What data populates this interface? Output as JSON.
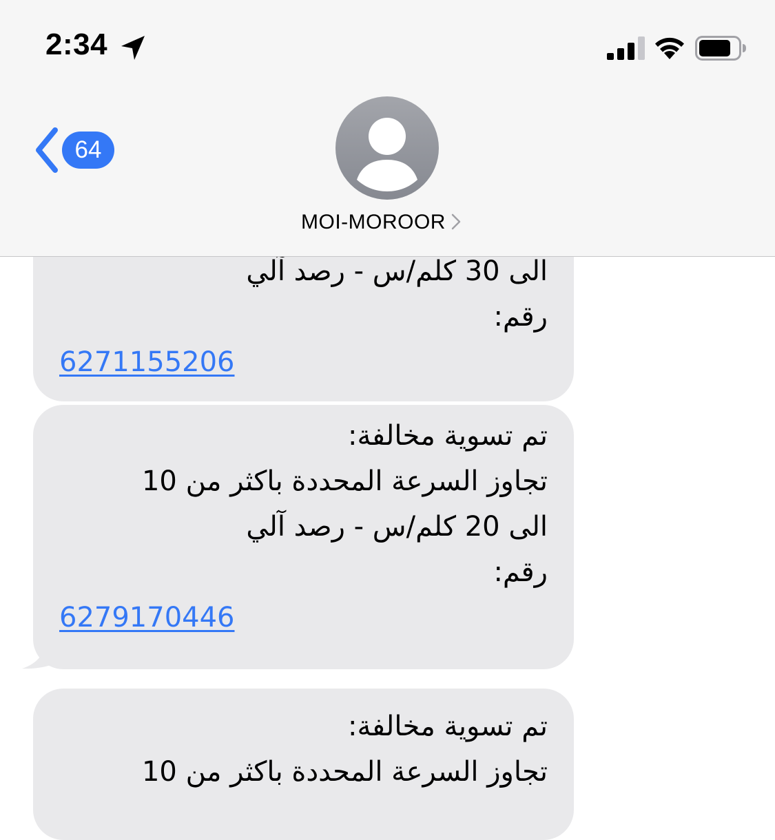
{
  "status_bar": {
    "time": "2:34",
    "location_icon": "location-arrow-icon",
    "signal_icon": "cellular-signal-icon",
    "wifi_icon": "wifi-icon",
    "battery_icon": "battery-icon"
  },
  "header": {
    "back_icon": "chevron-left-icon",
    "unread_count": "64",
    "avatar_icon": "person-icon",
    "contact_name": "MOI-MOROOR",
    "contact_chevron_icon": "chevron-right-icon"
  },
  "messages": [
    {
      "lines": [
        "الى 30 كلم/س - رصد آلي",
        "رقم:"
      ],
      "link": "6271155206"
    },
    {
      "lines": [
        "تم تسوية مخالفة:",
        "تجاوز السرعة المحددة باكثر من 10",
        "الى 20 كلم/س - رصد آلي",
        "رقم:"
      ],
      "link": "6279170446"
    },
    {
      "lines": [
        "تم تسوية مخالفة:",
        "تجاوز السرعة المحددة باكثر من 10"
      ]
    }
  ],
  "colors": {
    "accent": "#3478f6",
    "bubble": "#e9e9eb",
    "header_bg": "#f6f6f6"
  }
}
